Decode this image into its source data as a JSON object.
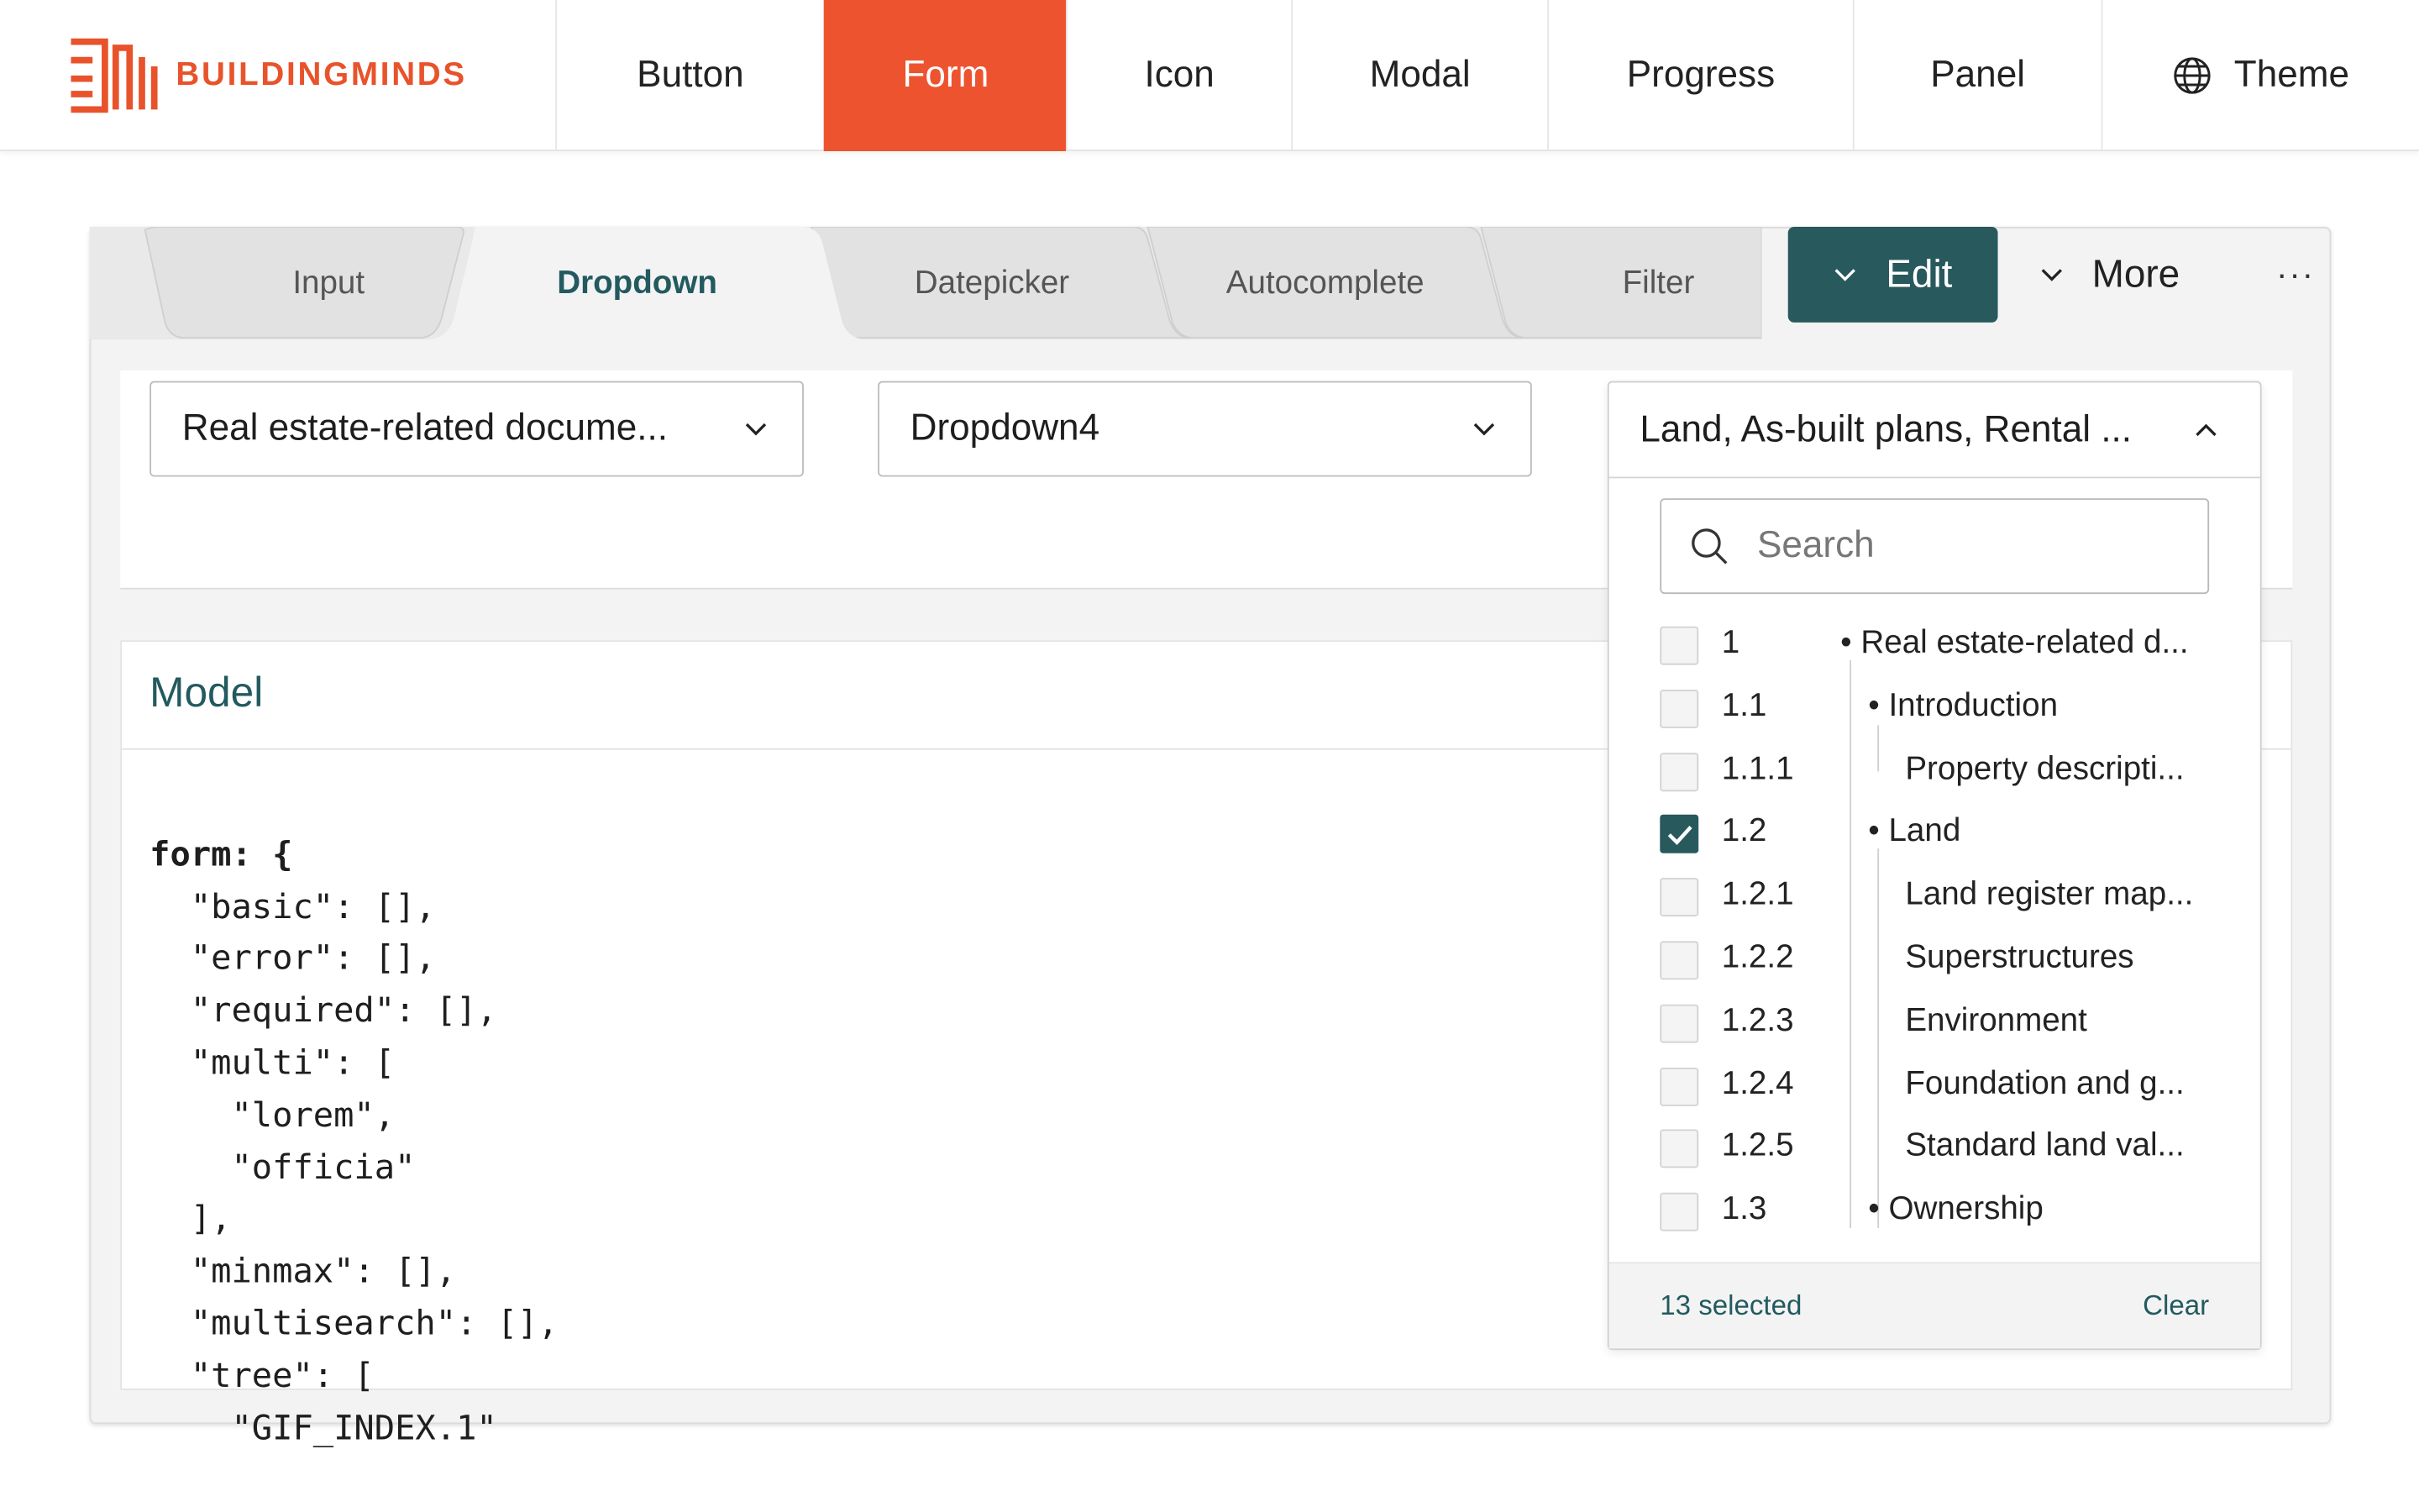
{
  "brand": {
    "name": "BUILDINGMINDS"
  },
  "nav": {
    "items": [
      {
        "label": "Button"
      },
      {
        "label": "Form"
      },
      {
        "label": "Icon"
      },
      {
        "label": "Modal"
      },
      {
        "label": "Progress"
      },
      {
        "label": "Panel"
      },
      {
        "label": "Theme"
      }
    ],
    "active": "Form"
  },
  "tabs": {
    "items": [
      {
        "label": "Input"
      },
      {
        "label": "Dropdown"
      },
      {
        "label": "Datepicker"
      },
      {
        "label": "Autocomplete"
      },
      {
        "label": "Filter"
      }
    ],
    "active": "Dropdown"
  },
  "actions": {
    "edit": "Edit",
    "more": "More",
    "overflow": "···"
  },
  "dropdowns": {
    "first": "Real estate-related docume...",
    "second": "Dropdown4",
    "third": "Land, As-built plans, Rental ..."
  },
  "popup": {
    "search_placeholder": "Search",
    "rows": [
      {
        "num": "1",
        "label": "Real estate-related d...",
        "checked": false
      },
      {
        "num": "1.1",
        "label": "Introduction",
        "checked": false
      },
      {
        "num": "1.1.1",
        "label": "Property descripti...",
        "checked": false
      },
      {
        "num": "1.2",
        "label": "Land",
        "checked": true
      },
      {
        "num": "1.2.1",
        "label": "Land register map...",
        "checked": false
      },
      {
        "num": "1.2.2",
        "label": "Superstructures",
        "checked": false
      },
      {
        "num": "1.2.3",
        "label": "Environment",
        "checked": false
      },
      {
        "num": "1.2.4",
        "label": "Foundation and g...",
        "checked": false
      },
      {
        "num": "1.2.5",
        "label": "Standard land val...",
        "checked": false
      },
      {
        "num": "1.3",
        "label": "Ownership",
        "checked": false
      }
    ],
    "selected_count": "13 selected",
    "clear": "Clear"
  },
  "model": {
    "title": "Model",
    "code_lines": [
      "form: {",
      "  \"basic\": [],",
      "  \"error\": [],",
      "  \"required\": [],",
      "  \"multi\": [",
      "    \"lorem\",",
      "    \"officia\"",
      "  ],",
      "  \"minmax\": [],",
      "  \"multisearch\": [],",
      "  \"tree\": [",
      "    \"GIF_INDEX.1\""
    ]
  },
  "colors": {
    "accent": "#ee5330",
    "primary": "#27595d",
    "link": "#225a5f"
  }
}
